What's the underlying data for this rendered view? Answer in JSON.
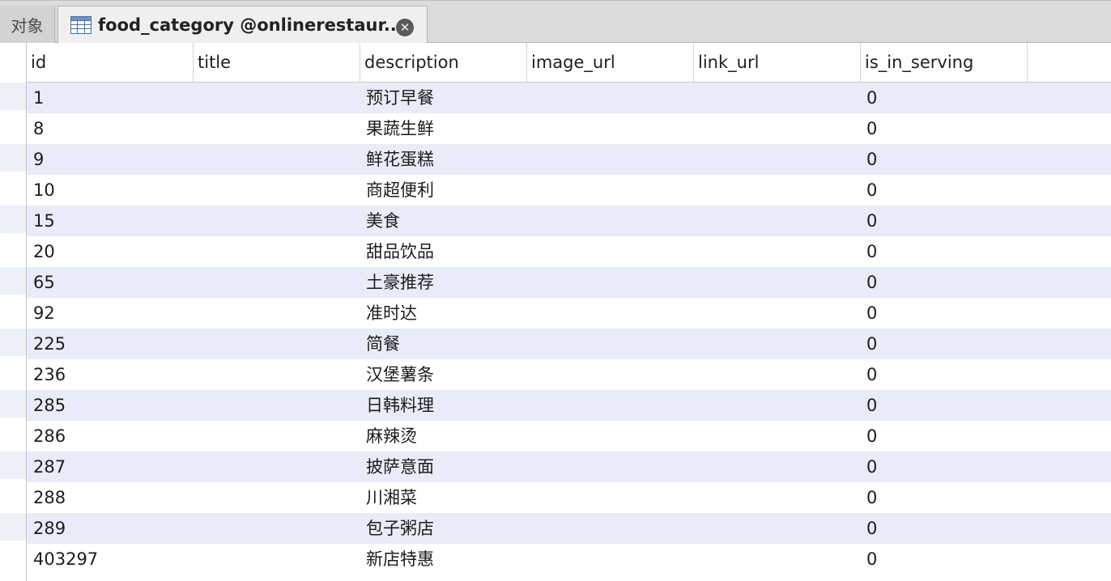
{
  "tabs": {
    "objects_label": "对象",
    "active_label": "food_category @onlinerestaur...",
    "table_icon": "table-icon",
    "close_icon": "close-icon"
  },
  "table": {
    "columns": [
      "id",
      "title",
      "description",
      "image_url",
      "link_url",
      "is_in_serving"
    ],
    "rows": [
      {
        "id": "1",
        "title": "",
        "description": "预订早餐",
        "image_url": "",
        "link_url": "",
        "is_in_serving": "0"
      },
      {
        "id": "8",
        "title": "",
        "description": "果蔬生鲜",
        "image_url": "",
        "link_url": "",
        "is_in_serving": "0"
      },
      {
        "id": "9",
        "title": "",
        "description": "鲜花蛋糕",
        "image_url": "",
        "link_url": "",
        "is_in_serving": "0"
      },
      {
        "id": "10",
        "title": "",
        "description": "商超便利",
        "image_url": "",
        "link_url": "",
        "is_in_serving": "0"
      },
      {
        "id": "15",
        "title": "",
        "description": "美食",
        "image_url": "",
        "link_url": "",
        "is_in_serving": "0"
      },
      {
        "id": "20",
        "title": "",
        "description": "甜品饮品",
        "image_url": "",
        "link_url": "",
        "is_in_serving": "0"
      },
      {
        "id": "65",
        "title": "",
        "description": "土豪推荐",
        "image_url": "",
        "link_url": "",
        "is_in_serving": "0"
      },
      {
        "id": "92",
        "title": "",
        "description": "准时达",
        "image_url": "",
        "link_url": "",
        "is_in_serving": "0"
      },
      {
        "id": "225",
        "title": "",
        "description": "简餐",
        "image_url": "",
        "link_url": "",
        "is_in_serving": "0"
      },
      {
        "id": "236",
        "title": "",
        "description": "汉堡薯条",
        "image_url": "",
        "link_url": "",
        "is_in_serving": "0"
      },
      {
        "id": "285",
        "title": "",
        "description": "日韩料理",
        "image_url": "",
        "link_url": "",
        "is_in_serving": "0"
      },
      {
        "id": "286",
        "title": "",
        "description": "麻辣烫",
        "image_url": "",
        "link_url": "",
        "is_in_serving": "0"
      },
      {
        "id": "287",
        "title": "",
        "description": "披萨意面",
        "image_url": "",
        "link_url": "",
        "is_in_serving": "0"
      },
      {
        "id": "288",
        "title": "",
        "description": "川湘菜",
        "image_url": "",
        "link_url": "",
        "is_in_serving": "0"
      },
      {
        "id": "289",
        "title": "",
        "description": "包子粥店",
        "image_url": "",
        "link_url": "",
        "is_in_serving": "0"
      },
      {
        "id": "403297",
        "title": "",
        "description": "新店特惠",
        "image_url": "",
        "link_url": "",
        "is_in_serving": "0"
      }
    ]
  },
  "colors": {
    "row_stripe": "#e9ecf8",
    "tabbar_bg": "#dcdcdc",
    "active_tab_bg": "#efefef"
  }
}
